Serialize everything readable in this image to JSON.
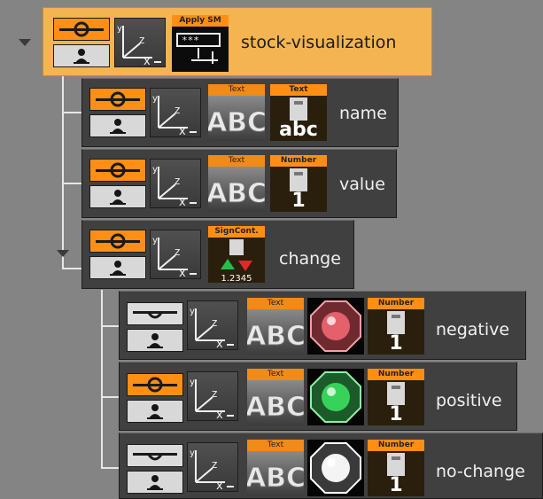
{
  "tree": {
    "root": {
      "label": "stock-visualization",
      "plugin_caption": "Apply SM",
      "plugin_icon": "apply-sm-icon",
      "plugin_text": "***"
    },
    "children": [
      {
        "label": "name",
        "text_caption": "Text",
        "text_glyph": "ABC",
        "data_caption": "Text",
        "data_glyph": "abc",
        "toggle": "on"
      },
      {
        "label": "value",
        "text_caption": "Text",
        "text_glyph": "ABC",
        "data_caption": "Number",
        "data_glyph": "1",
        "toggle": "on"
      },
      {
        "label": "change",
        "data_caption": "SignCont.",
        "data_glyph": "1.2345",
        "toggle": "on",
        "children": [
          {
            "label": "negative",
            "text_caption": "Text",
            "text_glyph": "ABC",
            "ball_color": "#e4606a",
            "data_caption": "Number",
            "data_glyph": "1",
            "toggle": "off"
          },
          {
            "label": "positive",
            "text_caption": "Text",
            "text_glyph": "ABC",
            "ball_color": "#38d25a",
            "data_caption": "Number",
            "data_glyph": "1",
            "toggle": "on"
          },
          {
            "label": "no-change",
            "text_caption": "Text",
            "text_glyph": "ABC",
            "ball_color": "#f4f4f4",
            "data_caption": "Number",
            "data_glyph": "1",
            "toggle": "off"
          }
        ]
      }
    ]
  },
  "icons": {
    "axis": [
      "y",
      "z",
      "x"
    ]
  },
  "colors": {
    "accent": "#ff8f14",
    "root_bg": "#f3b451",
    "node_bg": "#404040",
    "canvas": "#848484",
    "tree_lines": "#e6e6e6"
  }
}
